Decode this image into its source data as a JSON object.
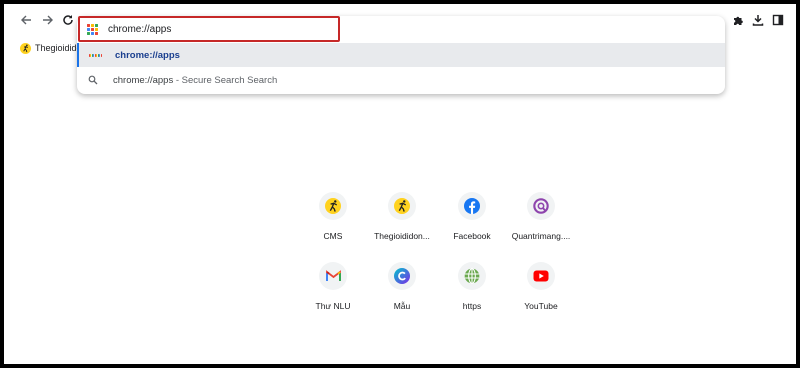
{
  "omnibox": {
    "value": "chrome://apps",
    "suggestions": [
      {
        "text": "chrome://apps",
        "desc": ""
      },
      {
        "text": "chrome://apps",
        "desc": " - Secure Search Search"
      }
    ]
  },
  "bookmarks": [
    {
      "label": "Thegioididon"
    }
  ],
  "shortcuts": [
    {
      "label": "CMS",
      "icon": "runner-icon"
    },
    {
      "label": "Thegioididon...",
      "icon": "runner-icon"
    },
    {
      "label": "Facebook",
      "icon": "facebook-icon"
    },
    {
      "label": "Quantrimang....",
      "icon": "quantrimang-icon"
    },
    {
      "label": "Thư NLU",
      "icon": "gmail-icon"
    },
    {
      "label": "Mẫu",
      "icon": "canva-icon"
    },
    {
      "label": "https",
      "icon": "globe-icon"
    },
    {
      "label": "YouTube",
      "icon": "youtube-icon"
    }
  ],
  "colors": {
    "highlight": "#c62828",
    "selected_row": "#e8eaed",
    "link_blue": "#1a3f8f",
    "facebook": "#1877f2",
    "youtube": "#ff0000",
    "runner_yellow": "#ffd21f",
    "quantrimang": "#8e44ad"
  }
}
